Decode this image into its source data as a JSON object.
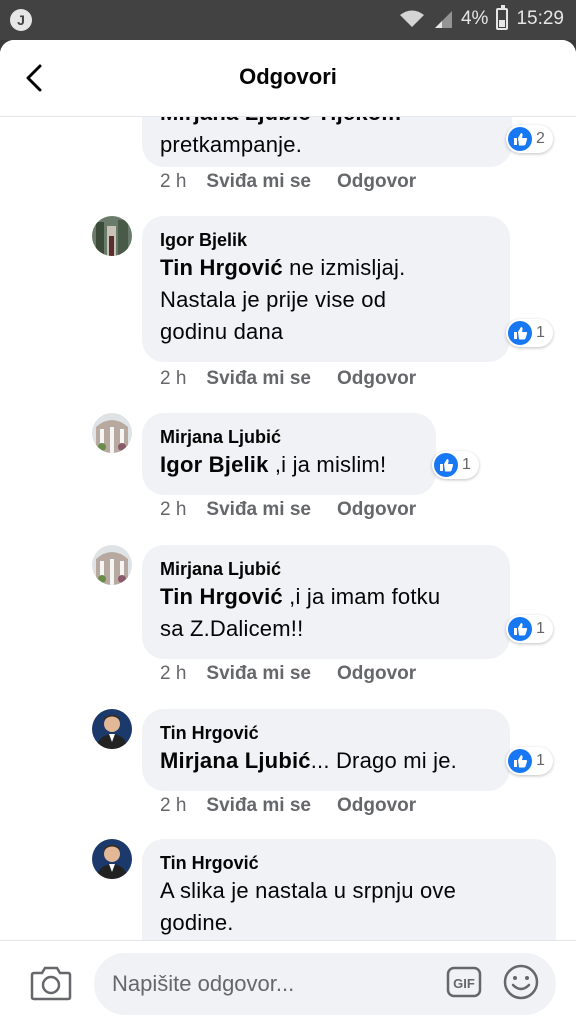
{
  "status_bar": {
    "battery": "4%",
    "time": "15:29",
    "left_icon_letter": "J"
  },
  "header": {
    "title": "Odgovori"
  },
  "comments": [
    {
      "author": "Mirjana Ljubić",
      "author_overlap": "Mirjana Ljubić  Tijekom",
      "text": "pretkampanje.",
      "time": "2 h",
      "like": "Sviđa mi se",
      "reply": "Odgovor",
      "reactions": "2"
    },
    {
      "author": "Igor Bjelik",
      "mention": "Tin Hrgović",
      "text": " ne izmisljaj.",
      "line2": "Nastala je prije vise od",
      "line3": "godinu dana",
      "time": "2 h",
      "like": "Sviđa mi se",
      "reply": "Odgovor",
      "reactions": "1"
    },
    {
      "author": "Mirjana Ljubić",
      "mention": "Igor Bjelik",
      "text": " ,i ja mislim!",
      "time": "2 h",
      "like": "Sviđa mi se",
      "reply": "Odgovor",
      "reactions": "1"
    },
    {
      "author": "Mirjana Ljubić",
      "mention": "Tin Hrgović",
      "text": " ,i ja imam fotku",
      "line2": "sa Z.Dalicem!!",
      "time": "2 h",
      "like": "Sviđa mi se",
      "reply": "Odgovor",
      "reactions": "1"
    },
    {
      "author": "Tin Hrgović",
      "mention": "Mirjana Ljubić",
      "text": "... Drago mi je.",
      "time": "2 h",
      "like": "Sviđa mi se",
      "reply": "Odgovor",
      "reactions": "1"
    },
    {
      "author": "Tin Hrgović",
      "text": "A slika je nastala u srpnju ove",
      "line2": "godine."
    }
  ],
  "composer": {
    "placeholder": "Napišite odgovor...",
    "gif_label": "GIF"
  },
  "colors": {
    "like_blue": "#1877f2",
    "bubble": "#f0f2f5",
    "meta_gray": "#65676b"
  },
  "icons": [
    "back-arrow-icon",
    "like-icon",
    "camera-icon",
    "gif-icon",
    "smiley-icon",
    "wifi-icon",
    "signal-icon",
    "battery-icon"
  ]
}
